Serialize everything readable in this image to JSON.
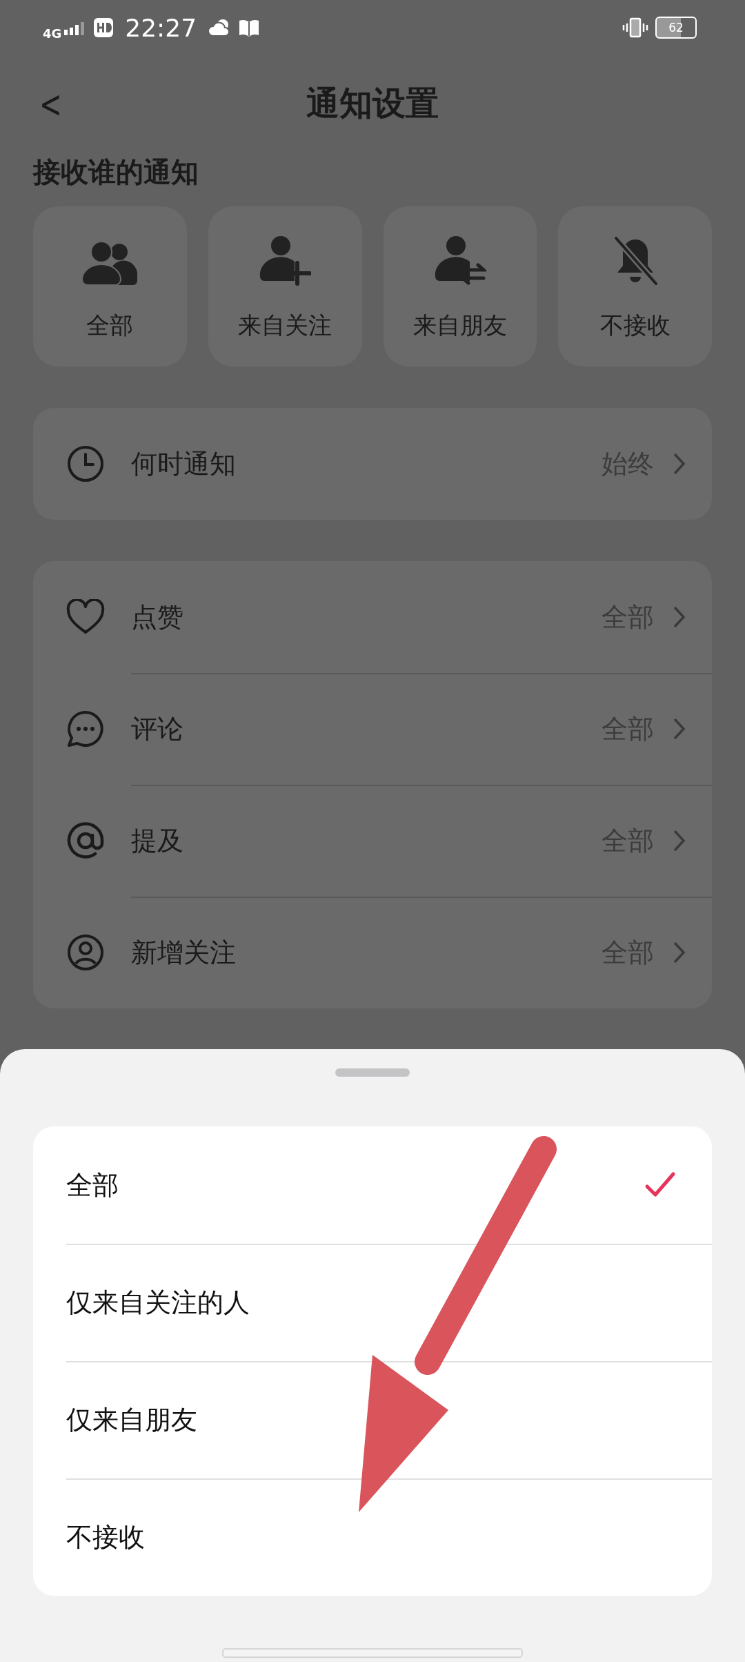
{
  "status_bar": {
    "network": "4G",
    "time": "22:27",
    "battery": "62"
  },
  "header": {
    "back": "<",
    "title": "通知设置"
  },
  "section_title": "接收谁的通知",
  "audience_options": [
    {
      "kind": "all",
      "label": "全部"
    },
    {
      "kind": "following",
      "label": "来自关注"
    },
    {
      "kind": "friends",
      "label": "来自朋友"
    },
    {
      "kind": "none",
      "label": "不接收"
    }
  ],
  "when_row": {
    "kind": "clock",
    "label": "何时通知",
    "value": "始终"
  },
  "type_rows": [
    {
      "kind": "heart",
      "label": "点赞",
      "value": "全部"
    },
    {
      "kind": "comment",
      "label": "评论",
      "value": "全部"
    },
    {
      "kind": "at",
      "label": "提及",
      "value": "全部"
    },
    {
      "kind": "user",
      "label": "新增关注",
      "value": "全部"
    }
  ],
  "sheet": {
    "options": [
      {
        "label": "全部",
        "selected": true
      },
      {
        "label": "仅来自关注的人",
        "selected": false
      },
      {
        "label": "仅来自朋友",
        "selected": false
      },
      {
        "label": "不接收",
        "selected": false
      }
    ]
  }
}
